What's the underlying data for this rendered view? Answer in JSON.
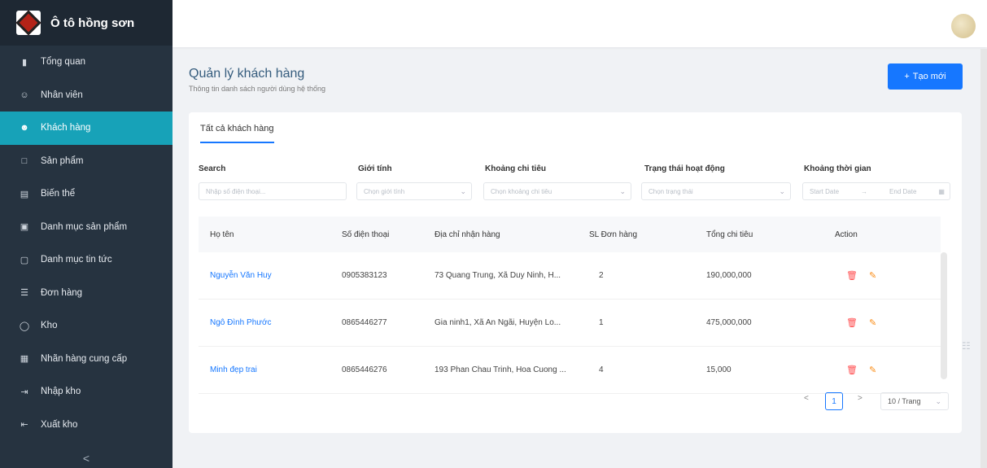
{
  "brand": {
    "name": "Ô tô hồng sơn"
  },
  "sidebar": {
    "items": [
      {
        "label": "Tổng quan",
        "icon": "bar-chart-icon"
      },
      {
        "label": "Nhân viên",
        "icon": "user-icon"
      },
      {
        "label": "Khách hàng",
        "icon": "users-icon",
        "active": true
      },
      {
        "label": "Sản phẩm",
        "icon": "box-icon"
      },
      {
        "label": "Biến thể",
        "icon": "layers-icon"
      },
      {
        "label": "Danh mục sản phẩm",
        "icon": "folder-icon"
      },
      {
        "label": "Danh mục tin tức",
        "icon": "news-icon"
      },
      {
        "label": "Đơn hàng",
        "icon": "list-icon"
      },
      {
        "label": "Kho",
        "icon": "warehouse-icon"
      },
      {
        "label": "Nhãn hàng cung cấp",
        "icon": "tag-icon"
      },
      {
        "label": "Nhập kho",
        "icon": "import-icon"
      },
      {
        "label": "Xuất kho",
        "icon": "export-icon"
      }
    ],
    "collapse_glyph": "<"
  },
  "page": {
    "title": "Quản lý khách hàng",
    "subtitle": "Thông tin danh sách người dùng hệ thống",
    "create_label": "Tạo mới"
  },
  "tabs": {
    "active": "Tất cả khách hàng"
  },
  "filters": {
    "search": {
      "label": "Search",
      "placeholder": "Nhập số điện thoại..."
    },
    "gender": {
      "label": "Giới tính",
      "placeholder": "Chọn giới tính"
    },
    "spend": {
      "label": "Khoảng chi tiêu",
      "placeholder": "Chọn khoảng chi tiêu"
    },
    "status": {
      "label": "Trạng thái hoạt động",
      "placeholder": "Chọn trạng thái"
    },
    "time": {
      "label": "Khoảng thời gian",
      "start": "Start Date",
      "end": "End Date"
    }
  },
  "table": {
    "columns": [
      "Họ tên",
      "Số điện thoại",
      "Địa chỉ nhận hàng",
      "SL Đơn hàng",
      "Tổng chi tiêu",
      "Action"
    ],
    "rows": [
      {
        "name": "Nguyễn Văn Huy",
        "phone": "0905383123",
        "address": "73 Quang Trung, Xã Duy Ninh, H...",
        "orders": "2",
        "total": "190,000,000"
      },
      {
        "name": "Ngô Đình Phước",
        "phone": "0865446277",
        "address": "Gia ninh1, Xã An Ngãi, Huyện Lo...",
        "orders": "1",
        "total": "475,000,000"
      },
      {
        "name": "Minh đẹp trai",
        "phone": "0865446276",
        "address": "193 Phan Chau Trinh, Hoa Cuong ...",
        "orders": "4",
        "total": "15,000"
      }
    ]
  },
  "pagination": {
    "prev": "<",
    "current": "1",
    "next": ">",
    "page_size": "10 / Trang"
  }
}
